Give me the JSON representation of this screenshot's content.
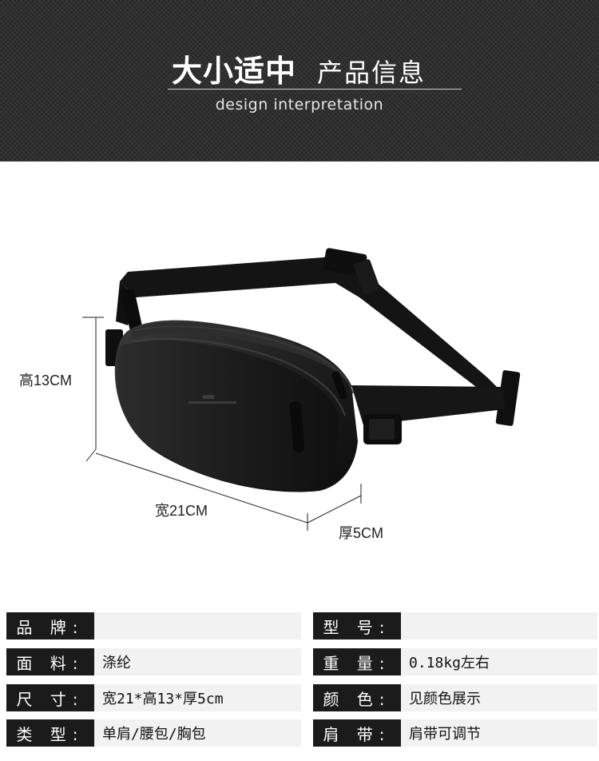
{
  "header": {
    "title_main": "大小适中",
    "title_sub": "产品信息",
    "subtitle_en": "design interpretation"
  },
  "dimensions": {
    "height": "高13CM",
    "width": "宽21CM",
    "depth": "厚5CM"
  },
  "specs": {
    "rows": [
      {
        "left_label": "品 牌:",
        "left_value": "",
        "right_label": "型 号:",
        "right_value": ""
      },
      {
        "left_label": "面 料:",
        "left_value": "涤纶",
        "right_label": "重 量:",
        "right_value": "0.18kg左右"
      },
      {
        "left_label": "尺 寸:",
        "left_value": "宽21*高13*厚5cm",
        "right_label": "颜 色:",
        "right_value": "见颜色展示"
      },
      {
        "left_label": "类 型:",
        "left_value": "单肩/腰包/胸包",
        "right_label": "肩 带:",
        "right_value": "肩带可调节"
      }
    ]
  },
  "colors": {
    "header_bg": "#2a2a2a",
    "label_bg": "#1b1b1b",
    "value_bg": "#f2f2f2"
  }
}
